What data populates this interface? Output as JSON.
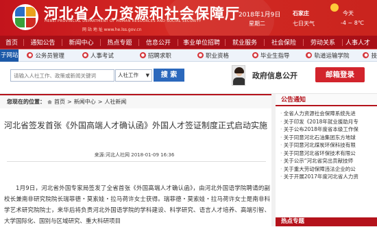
{
  "header": {
    "title": "河北省人力资源和社会保障厅",
    "subtitle_en": "HEBEI PROVINCIAL DEPARTMENT OF HUMAN RESOURCES AND SOCIAL SECURITY",
    "url": "网 站 地 址 www.he.lss.gov.cn",
    "date": "2018年1月9日",
    "weekday": "星期二",
    "city": "石家庄",
    "seven_day": "七日天气",
    "today": "今天",
    "temperature": "-4 ~ 8℃"
  },
  "nav": [
    "首页",
    "通知公告",
    "新闻中心",
    "热点专题",
    "信息公开",
    "事业单位招聘",
    "就业服务",
    "社会保险",
    "劳动关系",
    "人事人才"
  ],
  "subnav": {
    "label": "子网站",
    "items": [
      "公务员管理",
      "人事考试",
      "招聘求职",
      "职业资格",
      "毕业生指导",
      "轨道运输学院",
      "技"
    ]
  },
  "search": {
    "placeholder": "请输入人社工作、政策或新闻关键词",
    "scope": "人社工作",
    "button": "搜 索",
    "gov_info": "政府信息公开",
    "mailbox": "邮箱登录"
  },
  "breadcrumb": {
    "prefix": "您现在的位置：",
    "items": [
      "首页",
      "新闻中心",
      "人社新闻"
    ],
    "sep": ">"
  },
  "article": {
    "title": "河北省签发首张《外国高端人才确认函》外国人才签证制度正式启动实施",
    "meta": "来源:河北人社网    2018-01-09 16:36",
    "body": "1月9日，河北省外国专家局签发了全省首张《外国高端人才确认函》，由河北外国语学院聘请的副校长兼南非研究院院长瑞菲德・莫索娃・拉马荷许女士获得。瑞菲德・莫索娃・拉马荷许女士是南非科学艺术研究院院士，来华后将负责河北外国语学院的学科建设、科学研究、语言人才培养、高端引智、大学国际化、国别与区域研究、重大科研项目"
  },
  "notices": {
    "title": "公告通知",
    "items": [
      "全省人力资源社会保障系统先进",
      "关于印发《2018年就业援助月专",
      "关于公布2018年度省本级工作保",
      "关于同意河北石油集团东方地球",
      "关于同意河北煤炭环保科技有限",
      "关于同意河北省环保技术有限公",
      "关于公示“河北省突出贡献技师",
      "关于重大劳动保障违法企业的公",
      "关于开展2017年度河北省人力资"
    ],
    "hot": "热点专题"
  }
}
